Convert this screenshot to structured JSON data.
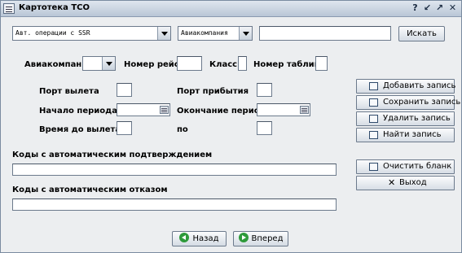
{
  "window": {
    "title": "Картотека ТСО",
    "help_glyph": "?",
    "minimize_glyph": "↙",
    "maximize_glyph": "↗",
    "close_glyph": "✕"
  },
  "search": {
    "operation_combo": "Авт. операции с SSR",
    "field_combo": "Авиакомпания",
    "query_value": "",
    "search_label": "Искать"
  },
  "form": {
    "airline_label": "Авиакомпания",
    "airline_value": "",
    "flight_label": "Номер рейса",
    "flight_value": "",
    "class_label": "Класс",
    "class_value": "",
    "table_label": "Номер таблицы",
    "table_value": "",
    "departure_port_label": "Порт вылета",
    "departure_port_value": "",
    "arrival_port_label": "Порт прибытия",
    "arrival_port_value": "",
    "period_start_label": "Начало периода",
    "period_start_value": "",
    "period_end_label": "Окончание периода",
    "period_end_value": "",
    "time_before_label": "Время до вылета: с",
    "time_before_from": "",
    "to_label": "по",
    "time_before_to": "",
    "auto_confirm_label": "Коды с автоматическим подтверждением",
    "auto_confirm_value": "",
    "auto_reject_label": "Коды с автоматическим отказом",
    "auto_reject_value": ""
  },
  "actions": {
    "add_label": "Добавить запись",
    "save_label": "Сохранить запись",
    "delete_label": "Удалить запись",
    "find_label": "Найти запись",
    "clear_label": "Очистить бланк",
    "exit_label": "Выход",
    "exit_glyph": "✕"
  },
  "nav": {
    "back_label": "Назад",
    "forward_label": "Вперед"
  }
}
